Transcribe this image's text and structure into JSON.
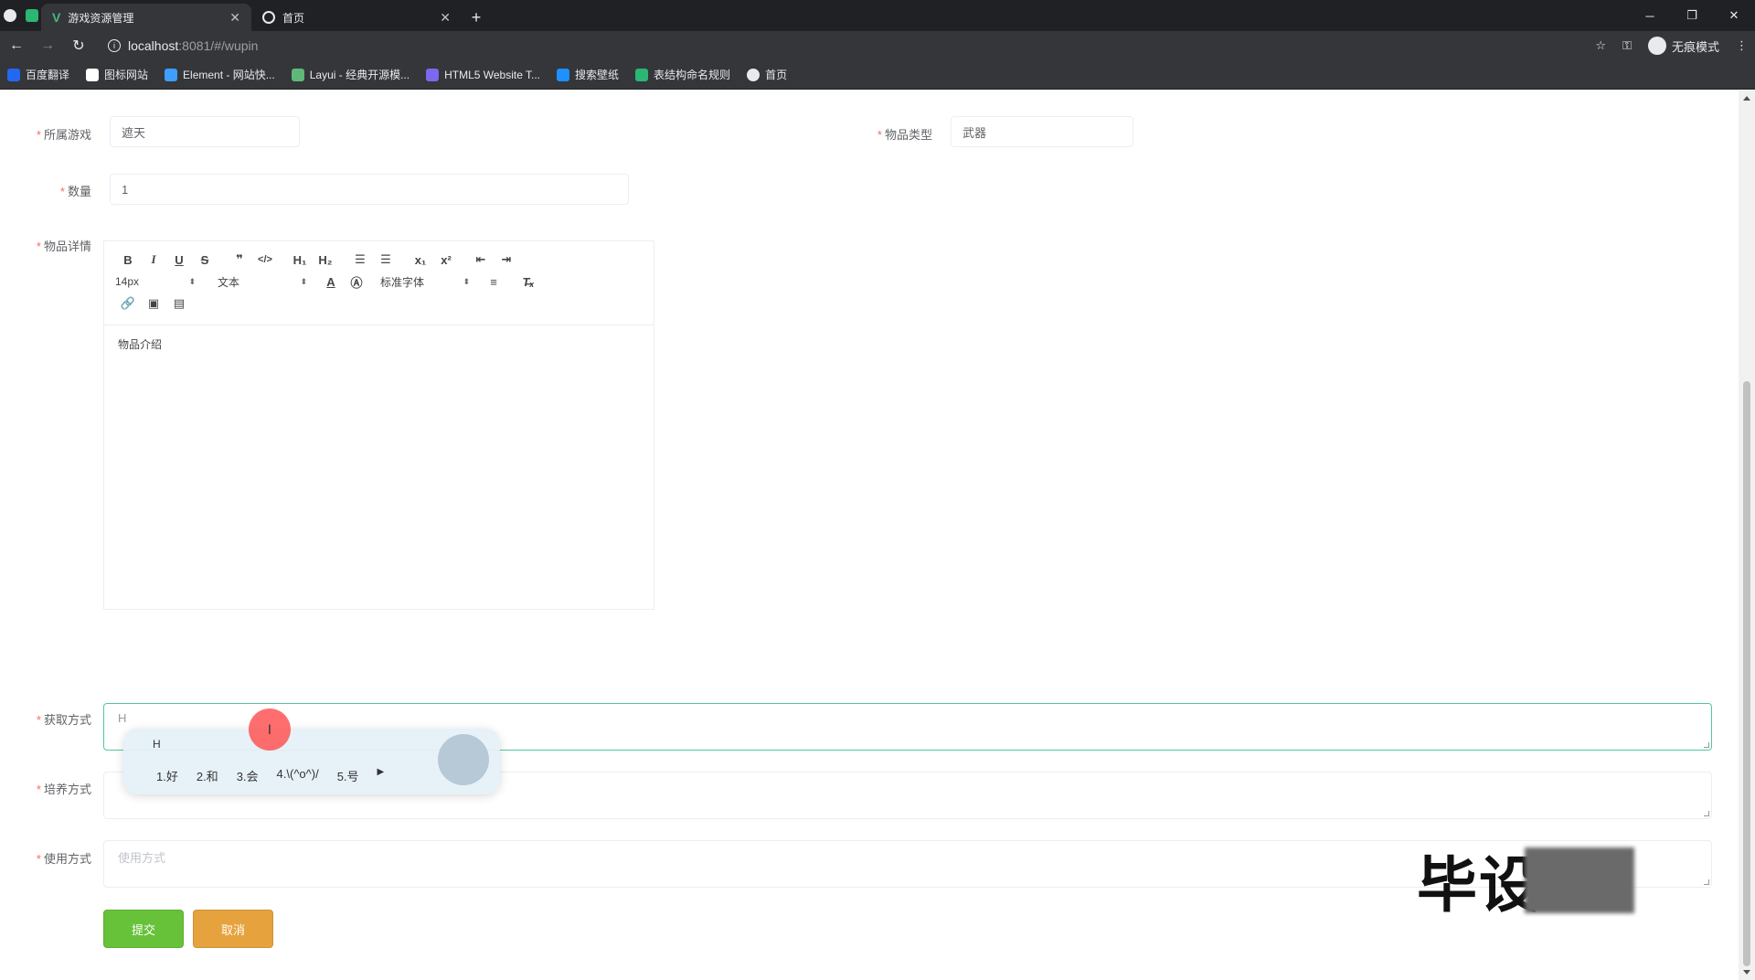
{
  "browser": {
    "tabs": [
      {
        "title": "游戏资源管理",
        "active": true
      },
      {
        "title": "首页",
        "active": false
      }
    ],
    "url_host": "localhost",
    "url_rest": ":8081/#/wupin",
    "profile_label": "无痕模式",
    "bookmarks": [
      {
        "label": "百度翻译",
        "color": "#2468f2"
      },
      {
        "label": "图标网站",
        "color": "#ffffff"
      },
      {
        "label": "Element - 网站快...",
        "color": "#409eff"
      },
      {
        "label": "Layui - 经典开源模...",
        "color": "#5fb878"
      },
      {
        "label": "HTML5 Website T...",
        "color": "#7b68ee"
      },
      {
        "label": "搜索壁纸",
        "color": "#1e90ff"
      },
      {
        "label": "表结构命名规则",
        "color": "#2bb673"
      },
      {
        "label": "首页",
        "color": "#e8eaed"
      }
    ]
  },
  "form": {
    "game": {
      "label": "所属游戏",
      "value": "遮天"
    },
    "item_type": {
      "label": "物品类型",
      "value": "武器"
    },
    "quantity": {
      "label": "数量",
      "value": "1"
    },
    "detail": {
      "label": "物品详情",
      "font_size": "14px",
      "header": "文本",
      "font_family": "标准字体",
      "content": "物品介绍"
    },
    "obtain": {
      "label": "获取方式",
      "value": "H"
    },
    "cultivate": {
      "label": "培养方式",
      "placeholder": ""
    },
    "usage": {
      "label": "使用方式",
      "placeholder": "使用方式"
    },
    "submit_label": "提交",
    "cancel_label": "取消"
  },
  "ime": {
    "typed": "H",
    "candidates": [
      "1.好",
      "2.和",
      "3.会",
      "4.\\(^o^)/",
      "5.号"
    ]
  },
  "watermark": "毕设",
  "colors": {
    "submit": "#67c23a",
    "cancel": "#e6a23c",
    "focus_border": "#52c6a1",
    "required": "#f56c6c"
  }
}
